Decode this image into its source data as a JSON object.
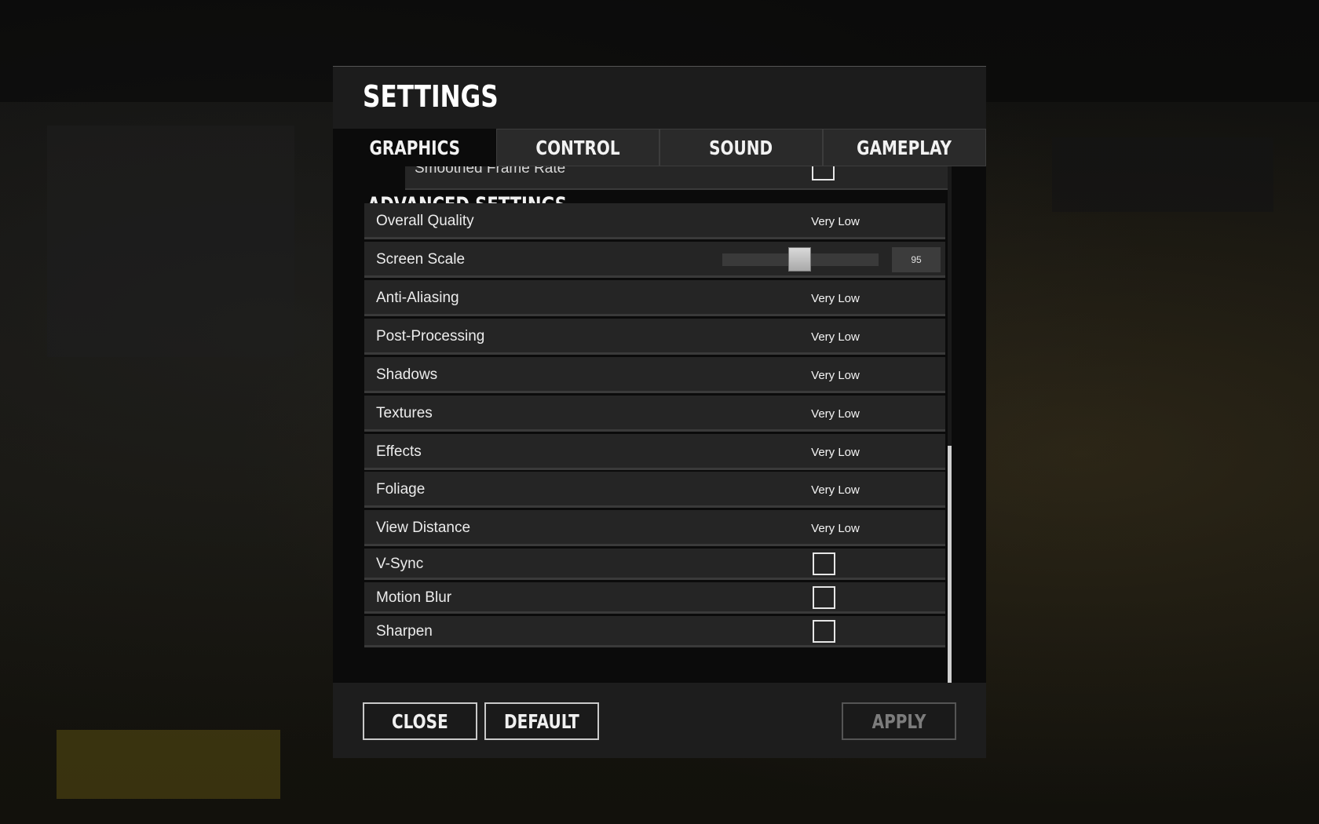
{
  "dialog": {
    "title": "SETTINGS"
  },
  "tabs": [
    {
      "label": "GRAPHICS",
      "active": true
    },
    {
      "label": "CONTROL",
      "active": false
    },
    {
      "label": "SOUND",
      "active": false
    },
    {
      "label": "GAMEPLAY",
      "active": false
    }
  ],
  "partial_row": {
    "label": "Smoothed Frame Rate"
  },
  "advanced": {
    "title": "ADVANCED SETTINGS",
    "rows": [
      {
        "label": "Overall Quality",
        "value": "Very Low"
      },
      {
        "label": "Screen Scale",
        "slider_value": "95"
      },
      {
        "label": "Anti-Aliasing",
        "value": "Very Low"
      },
      {
        "label": "Post-Processing",
        "value": "Very Low"
      },
      {
        "label": "Shadows",
        "value": "Very Low"
      },
      {
        "label": "Textures",
        "value": "Very Low"
      },
      {
        "label": "Effects",
        "value": "Very Low"
      },
      {
        "label": "Foliage",
        "value": "Very Low"
      },
      {
        "label": "View Distance",
        "value": "Very Low"
      },
      {
        "label": "V-Sync",
        "checked": false
      },
      {
        "label": "Motion Blur",
        "checked": false
      },
      {
        "label": "Sharpen",
        "checked": false
      }
    ]
  },
  "footer": {
    "close_label": "CLOSE",
    "default_label": "DEFAULT",
    "apply_label": "APPLY"
  },
  "colors": {
    "panel": "#1c1c1c",
    "row": "#252525",
    "accent_text": "#ffffff",
    "disabled_text": "#7c7c7c"
  }
}
